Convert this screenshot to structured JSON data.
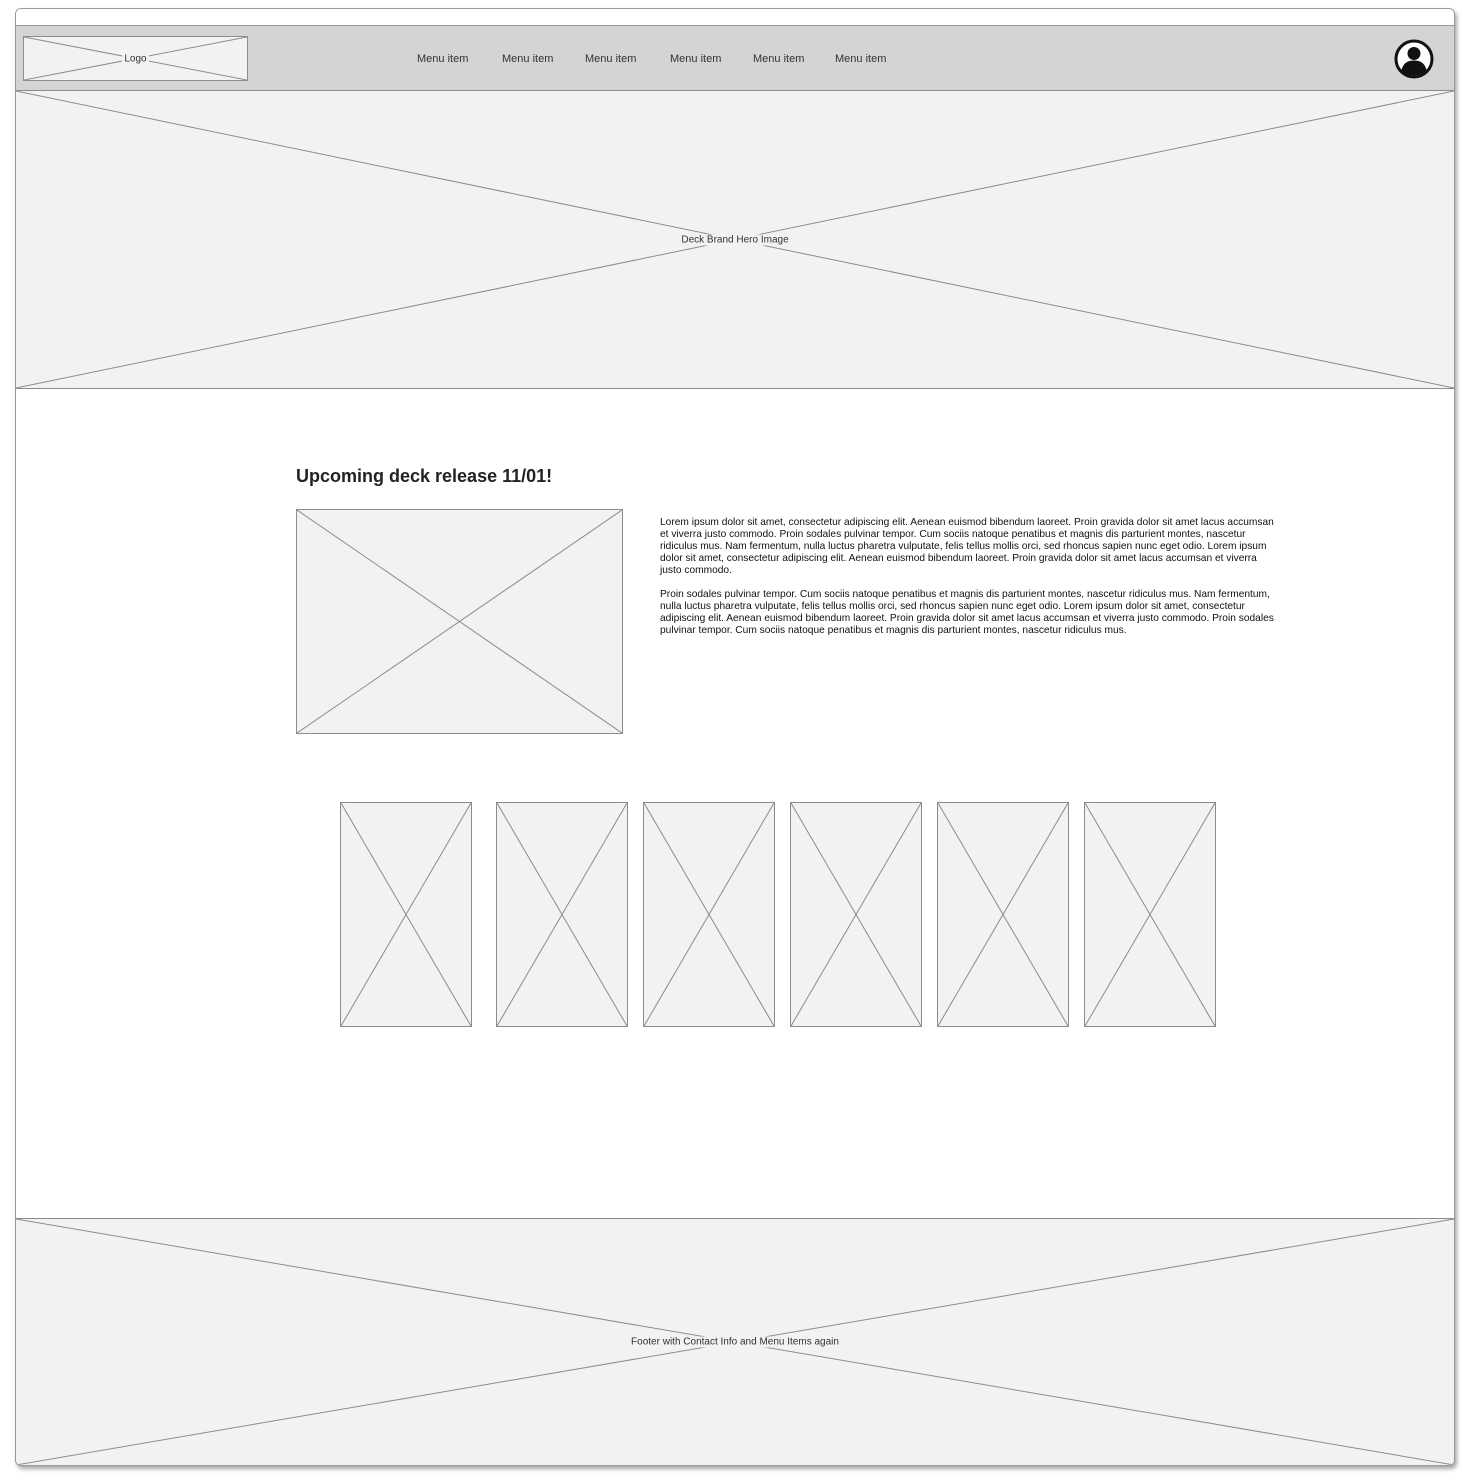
{
  "header": {
    "logo_label": "Logo",
    "nav": [
      {
        "label": "Menu item"
      },
      {
        "label": "Menu item"
      },
      {
        "label": "Menu item"
      },
      {
        "label": "Menu item"
      },
      {
        "label": "Menu item"
      },
      {
        "label": "Menu item"
      }
    ],
    "avatar_icon": "user-avatar-icon"
  },
  "hero": {
    "label": "Deck Brand Hero Image"
  },
  "main": {
    "headline": "Upcoming deck release 11/01!",
    "paragraphs": [
      "Lorem ipsum dolor sit amet, consectetur adipiscing elit. Aenean euismod bibendum laoreet. Proin gravida dolor sit amet lacus accumsan et viverra justo commodo. Proin sodales pulvinar tempor. Cum sociis natoque penatibus et magnis dis parturient montes, nascetur ridiculus mus. Nam fermentum, nulla luctus pharetra vulputate, felis tellus mollis orci, sed rhoncus sapien nunc eget odio. Lorem ipsum dolor sit amet, consectetur adipiscing elit. Aenean euismod bibendum laoreet. Proin gravida dolor sit amet lacus accumsan et viverra justo commodo.",
      "Proin sodales pulvinar tempor. Cum sociis natoque penatibus et magnis dis parturient montes, nascetur ridiculus mus. Nam fermentum, nulla luctus pharetra vulputate, felis tellus mollis orci, sed rhoncus sapien nunc eget odio. Lorem ipsum dolor sit amet, consectetur adipiscing elit. Aenean euismod bibendum laoreet. Proin gravida dolor sit amet lacus accumsan et viverra justo commodo. Proin sodales pulvinar tempor. Cum sociis natoque penatibus et magnis dis parturient montes, nascetur ridiculus mus."
    ]
  },
  "footer": {
    "label": "Footer with Contact Info and Menu Items again"
  },
  "colors": {
    "header_bg": "#d4d4d4",
    "placeholder_bg": "#f2f2f2",
    "placeholder_stroke": "#8c8c8c"
  }
}
